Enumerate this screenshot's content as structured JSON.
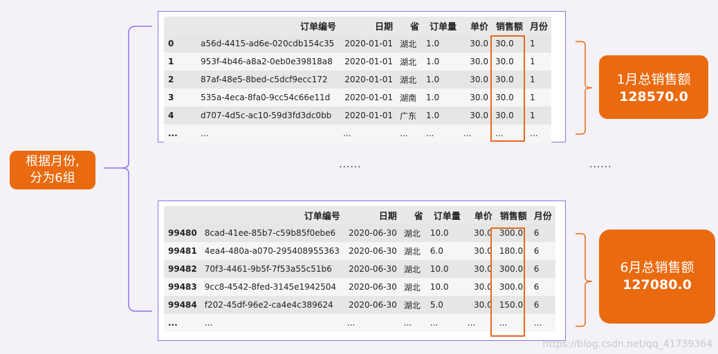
{
  "group_label": {
    "line1": "根据月份,",
    "line2": "分为6组"
  },
  "columns": {
    "order_id": "订单编号",
    "date": "日期",
    "province": "省",
    "quantity": "订单量",
    "price": "单价",
    "sales": "销售额",
    "month": "月份"
  },
  "top_table": {
    "rows": [
      {
        "idx": "0",
        "order_id": "a56d-4415-ad6e-020cdb154c35",
        "date": "2020-01-01",
        "province": "湖北",
        "quantity": "1.0",
        "price": "30.0",
        "sales": "30.0",
        "month": "1"
      },
      {
        "idx": "1",
        "order_id": "953f-4b46-a8a2-0eb0e39818a8",
        "date": "2020-01-01",
        "province": "湖北",
        "quantity": "1.0",
        "price": "30.0",
        "sales": "30.0",
        "month": "1"
      },
      {
        "idx": "2",
        "order_id": "87af-48e5-8bed-c5dcf9ecc172",
        "date": "2020-01-01",
        "province": "湖北",
        "quantity": "1.0",
        "price": "30.0",
        "sales": "30.0",
        "month": "1"
      },
      {
        "idx": "3",
        "order_id": "535a-4eca-8fa0-9cc54c66e11d",
        "date": "2020-01-01",
        "province": "湖南",
        "quantity": "1.0",
        "price": "30.0",
        "sales": "30.0",
        "month": "1"
      },
      {
        "idx": "4",
        "order_id": "d707-4d5c-ac10-59d3fd3dc0bb",
        "date": "2020-01-01",
        "province": "广东",
        "quantity": "1.0",
        "price": "30.0",
        "sales": "30.0",
        "month": "1"
      }
    ]
  },
  "bottom_table": {
    "rows": [
      {
        "idx": "99480",
        "order_id": "8cad-41ee-85b7-c59b85f0ebe6",
        "date": "2020-06-30",
        "province": "湖北",
        "quantity": "10.0",
        "price": "30.0",
        "sales": "300.0",
        "month": "6"
      },
      {
        "idx": "99481",
        "order_id": "4ea4-480a-a070-295408955363",
        "date": "2020-06-30",
        "province": "湖北",
        "quantity": "6.0",
        "price": "30.0",
        "sales": "180.0",
        "month": "6"
      },
      {
        "idx": "99482",
        "order_id": "70f3-4461-9b5f-7f53a55c51b6",
        "date": "2020-06-30",
        "province": "湖北",
        "quantity": "10.0",
        "price": "30.0",
        "sales": "300.0",
        "month": "6"
      },
      {
        "idx": "99483",
        "order_id": "9cc8-4542-8fed-3145e1942504",
        "date": "2020-06-30",
        "province": "湖北",
        "quantity": "10.0",
        "price": "30.0",
        "sales": "300.0",
        "month": "6"
      },
      {
        "idx": "99484",
        "order_id": "f202-45df-96e2-ca4e4c389624",
        "date": "2020-06-30",
        "province": "湖北",
        "quantity": "5.0",
        "price": "30.0",
        "sales": "150.0",
        "month": "6"
      }
    ]
  },
  "truncation_cell": "...",
  "ellipsis_text": "......",
  "month1_total": {
    "label": "1月总销售额",
    "value": "128570.0"
  },
  "month6_total": {
    "label": "6月总销售额",
    "value": "127080.0"
  },
  "watermark": "https://blog.csdn.net/qq_41739364",
  "colors": {
    "frame": "#8b72e6",
    "accent": "#ea6a10",
    "highlight": "#e8661c"
  }
}
